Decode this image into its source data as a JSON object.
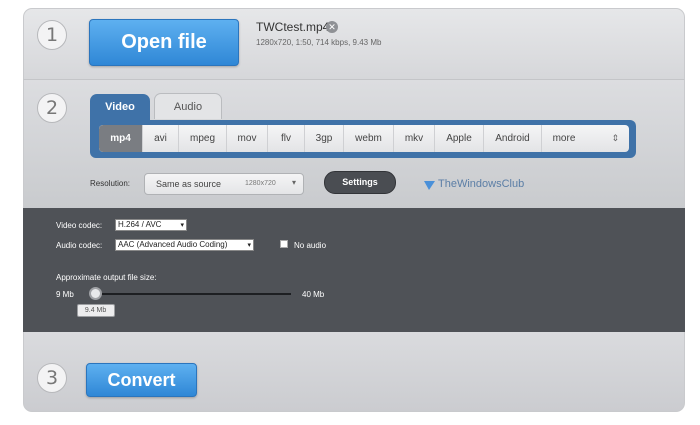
{
  "step1": {
    "number": "1",
    "open_label": "Open file",
    "file_name": "TWCtest.mp4",
    "close_icon": "close-circle-icon",
    "file_info": "1280x720, 1:50, 714 kbps, 9.43 Mb"
  },
  "step2": {
    "number": "2",
    "tabs": [
      {
        "label": "Video",
        "active": true
      },
      {
        "label": "Audio",
        "active": false
      }
    ],
    "formats": [
      "mp4",
      "avi",
      "mpeg",
      "mov",
      "flv",
      "3gp",
      "webm",
      "mkv",
      "Apple",
      "Android",
      "more"
    ],
    "active_format": "mp4",
    "formats_arrow_icon": "up-down-arrows-icon",
    "resolution_label": "Resolution:",
    "resolution_value": "Same as source",
    "resolution_dim": "1280x720",
    "settings_label": "Settings",
    "watermark": "TheWindowsClub"
  },
  "advanced": {
    "video_codec_label": "Video codec:",
    "video_codec_value": "H.264 / AVC",
    "audio_codec_label": "Audio codec:",
    "audio_codec_value": "AAC (Advanced Audio Coding)",
    "no_audio_label": "No audio",
    "no_audio_checked": false,
    "size_label": "Approximate output file size:",
    "size_min": "9 Mb",
    "size_max": "40 Mb",
    "size_current": "9.4 Mb",
    "slider_fraction": 0.013
  },
  "step3": {
    "number": "3",
    "convert_label": "Convert"
  },
  "colors": {
    "accent_blue": "#3f72a8",
    "button_blue": "#2f87d6",
    "dark_panel": "#4f5257"
  }
}
